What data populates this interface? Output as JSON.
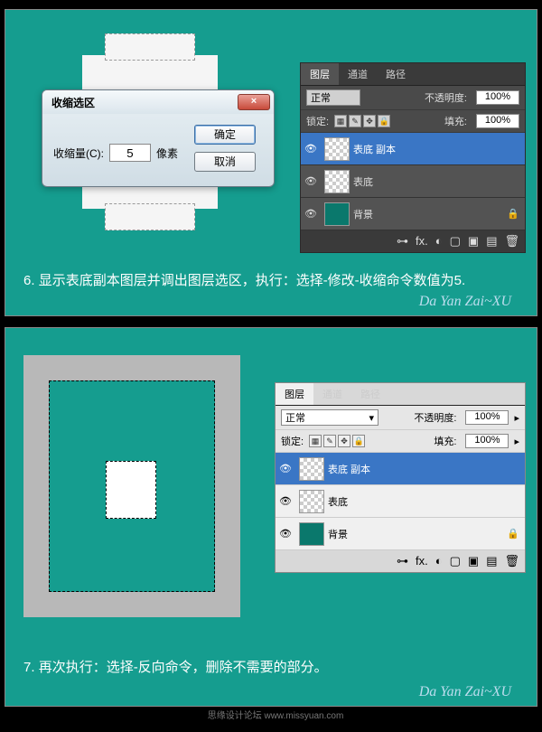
{
  "dialog": {
    "title": "收缩选区",
    "field_label": "收缩量(C):",
    "value": "5",
    "unit": "像素",
    "ok": "确定",
    "cancel": "取消",
    "close": "×"
  },
  "layers_panel": {
    "tabs": [
      "图层",
      "通道",
      "路径"
    ],
    "blend_mode": "正常",
    "opacity_label": "不透明度:",
    "opacity_value": "100%",
    "lock_label": "锁定:",
    "fill_label": "填充:",
    "fill_value": "100%",
    "layers": [
      {
        "name": "表底 副本",
        "selected": true,
        "teal": false
      },
      {
        "name": "表底",
        "selected": false,
        "teal": false
      },
      {
        "name": "背景",
        "selected": false,
        "teal": true,
        "locked": true
      }
    ],
    "footer_icons": [
      "⊶",
      "fx.",
      "◐",
      "▢",
      "▣",
      "▤",
      "🗑"
    ]
  },
  "step6": {
    "num": "6.",
    "text": "显示表底副本图层并调出图层选区，执行：选择-修改-收缩命令数值为5."
  },
  "step7": {
    "num": "7.",
    "text": "再次执行：选择-反向命令，删除不需要的部分。"
  },
  "signature": "Da Yan Zai~XU",
  "watermark": "思缘设计论坛   www.missyuan.com"
}
